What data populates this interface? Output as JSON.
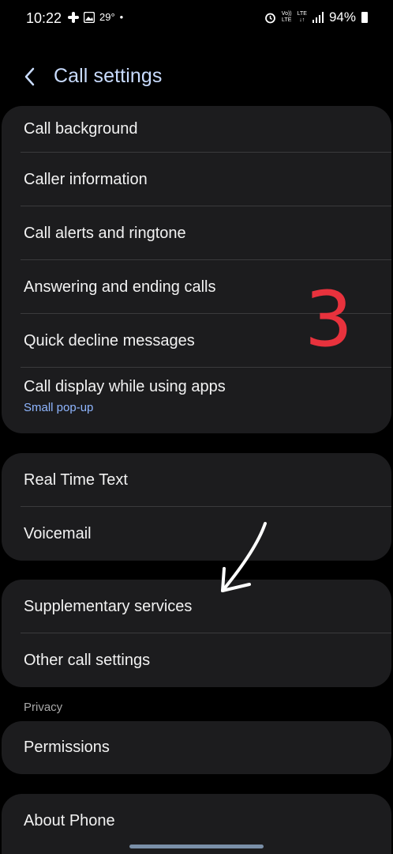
{
  "status_bar": {
    "time": "10:22",
    "temperature": "29°",
    "dot": "•",
    "volte_top": "Vo))",
    "volte_bottom": "LTE",
    "lte_top": "LTE",
    "lte_bottom": "↓↑",
    "battery": "94%"
  },
  "header": {
    "title": "Call settings"
  },
  "groups": [
    {
      "items": [
        {
          "label": "Call background"
        },
        {
          "label": "Caller information"
        },
        {
          "label": "Call alerts and ringtone"
        },
        {
          "label": "Answering and ending calls"
        },
        {
          "label": "Quick decline messages"
        },
        {
          "label": "Call display while using apps",
          "sub": "Small pop-up"
        }
      ]
    },
    {
      "items": [
        {
          "label": "Real Time Text"
        },
        {
          "label": "Voicemail"
        }
      ]
    },
    {
      "items": [
        {
          "label": "Supplementary services"
        },
        {
          "label": "Other call settings"
        }
      ]
    }
  ],
  "privacy": {
    "section_label": "Privacy",
    "items": [
      {
        "label": "Permissions"
      }
    ]
  },
  "about": {
    "label": "About Phone"
  },
  "annotation": {
    "number": "3",
    "color": "#e8323d"
  },
  "colors": {
    "background": "#000000",
    "card": "#1c1c1e",
    "title": "#c9dcff",
    "subtext": "#8fb6ff"
  }
}
